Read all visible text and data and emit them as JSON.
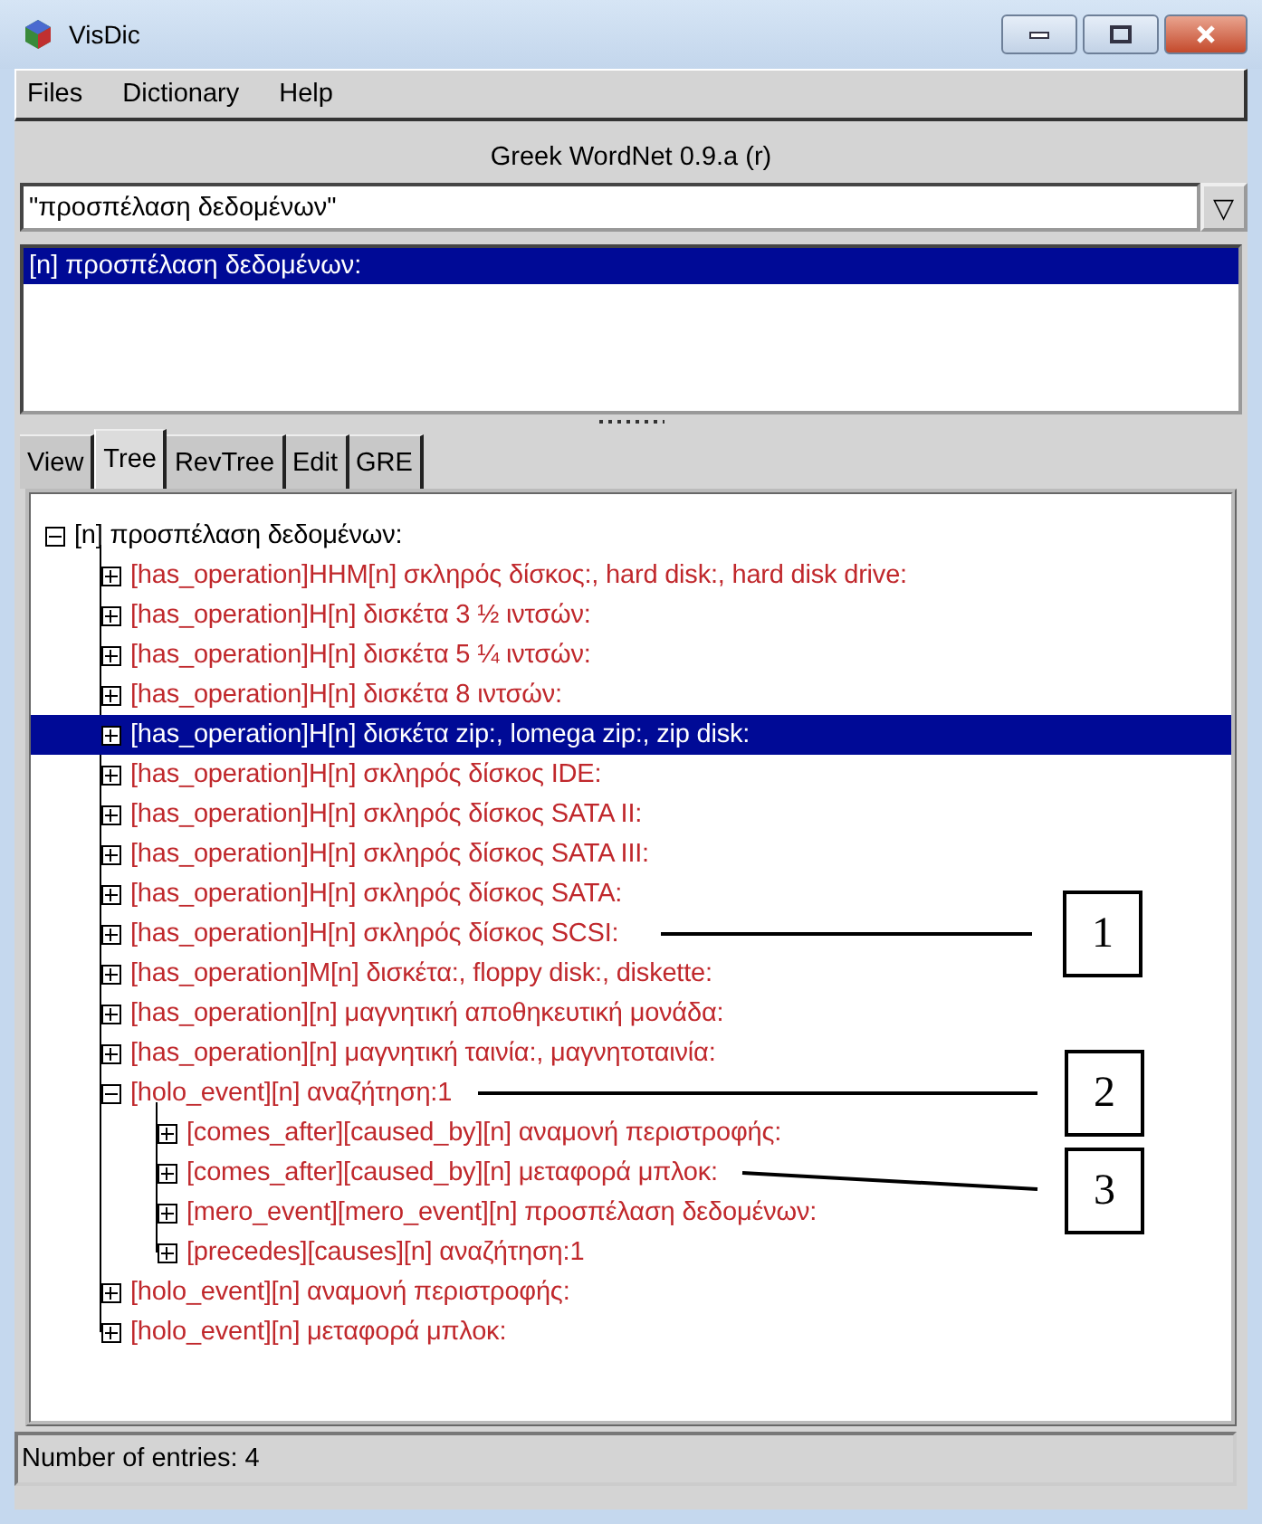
{
  "window": {
    "title": "VisDic"
  },
  "menu": [
    "Files",
    "Dictionary",
    "Help"
  ],
  "header": "Greek WordNet 0.9.a (r)",
  "search": {
    "value": "\"προσπέλαση δεδομένων\"",
    "dropdown": "▽"
  },
  "results": [
    {
      "text": "[n] προσπέλαση δεδομένων:",
      "selected": true
    }
  ],
  "tabs": [
    {
      "label": "View",
      "selected": false
    },
    {
      "label": "Tree",
      "selected": true
    },
    {
      "label": "RevTree",
      "selected": false
    },
    {
      "label": "Edit",
      "selected": false
    },
    {
      "label": "GRE",
      "selected": false
    }
  ],
  "tree": {
    "text": "[n] προσπέλαση δεδομένων:",
    "expanded": true,
    "selected": false,
    "children": [
      {
        "text": "[has_operation]HHM[n] σκληρός δίσκος:, hard disk:, hard disk drive:",
        "expanded": false,
        "selected": false
      },
      {
        "text": "[has_operation]H[n] δισκέτα 3 ½ ιντσών:",
        "expanded": false,
        "selected": false
      },
      {
        "text": "[has_operation]H[n] δισκέτα 5 ¼ ιντσών:",
        "expanded": false,
        "selected": false
      },
      {
        "text": "[has_operation]H[n] δισκέτα 8 ιντσών:",
        "expanded": false,
        "selected": false
      },
      {
        "text": "[has_operation]H[n] δισκέτα zip:, lomega zip:, zip disk:",
        "expanded": false,
        "selected": true
      },
      {
        "text": "[has_operation]H[n] σκληρός δίσκος IDE:",
        "expanded": false,
        "selected": false
      },
      {
        "text": "[has_operation]H[n] σκληρός δίσκος SATA II:",
        "expanded": false,
        "selected": false
      },
      {
        "text": "[has_operation]H[n] σκληρός δίσκος SATA III:",
        "expanded": false,
        "selected": false
      },
      {
        "text": "[has_operation]H[n] σκληρός δίσκος SATA:",
        "expanded": false,
        "selected": false
      },
      {
        "text": "[has_operation]H[n] σκληρός δίσκος SCSI:",
        "expanded": false,
        "selected": false
      },
      {
        "text": "[has_operation]M[n] δισκέτα:, floppy disk:, diskette:",
        "expanded": false,
        "selected": false
      },
      {
        "text": "[has_operation][n] μαγνητική αποθηκευτική μονάδα:",
        "expanded": false,
        "selected": false
      },
      {
        "text": "[has_operation][n] μαγνητική ταινία:, μαγνητοταινία:",
        "expanded": false,
        "selected": false
      },
      {
        "text": "[holo_event][n] αναζήτηση:1",
        "expanded": true,
        "selected": false,
        "children": [
          {
            "text": "[comes_after][caused_by][n] αναμονή περιστροφής:",
            "expanded": false,
            "selected": false
          },
          {
            "text": "[comes_after][caused_by][n] μεταφορά μπλοκ:",
            "expanded": false,
            "selected": false
          },
          {
            "text": "[mero_event][mero_event][n] προσπέλαση δεδομένων:",
            "expanded": false,
            "selected": false
          },
          {
            "text": "[precedes][causes][n] αναζήτηση:1",
            "expanded": false,
            "selected": false
          }
        ]
      },
      {
        "text": "[holo_event][n] αναμονή περιστροφής:",
        "expanded": false,
        "selected": false
      },
      {
        "text": "[holo_event][n] μεταφορά μπλοκ:",
        "expanded": false,
        "selected": false
      }
    ]
  },
  "status_bar": "Number of entries: 4",
  "annotations": [
    {
      "label": "1"
    },
    {
      "label": "2"
    },
    {
      "label": "3"
    }
  ]
}
